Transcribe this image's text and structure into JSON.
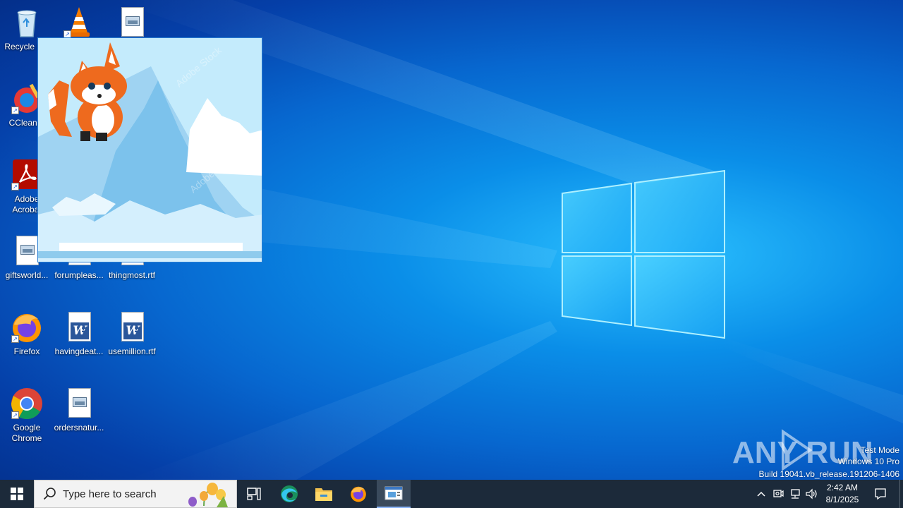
{
  "desktop": {
    "icons": [
      {
        "label": "Recycle Bin"
      },
      {
        "label": "VLC media player"
      },
      {
        "label": "image file"
      },
      {
        "label": "CCleaner"
      },
      {
        "label": "Adobe Acrobat"
      },
      {
        "label": "giftsworld..."
      },
      {
        "label": "forumpleas..."
      },
      {
        "label": "thingmost.rtf"
      },
      {
        "label": "Firefox"
      },
      {
        "label": "havingdeat..."
      },
      {
        "label": "usemillion.rtf"
      },
      {
        "label": "Google Chrome"
      },
      {
        "label": "ordersnatur..."
      }
    ]
  },
  "image_window": {
    "watermark_text": "Adobe Stock"
  },
  "watermark": {
    "brand": "ANY RUN",
    "line1": "Test Mode",
    "line2": "Windows 10 Pro",
    "line3": "Build 19041.vb_release.191206-1406"
  },
  "taskbar": {
    "search_placeholder": "Type here to search",
    "clock_time": "2:42 AM",
    "clock_date": "8/1/2025"
  },
  "colors": {
    "taskbar": "#1c2a3a",
    "accent": "#0a8ee8",
    "word": "#2b579a"
  }
}
